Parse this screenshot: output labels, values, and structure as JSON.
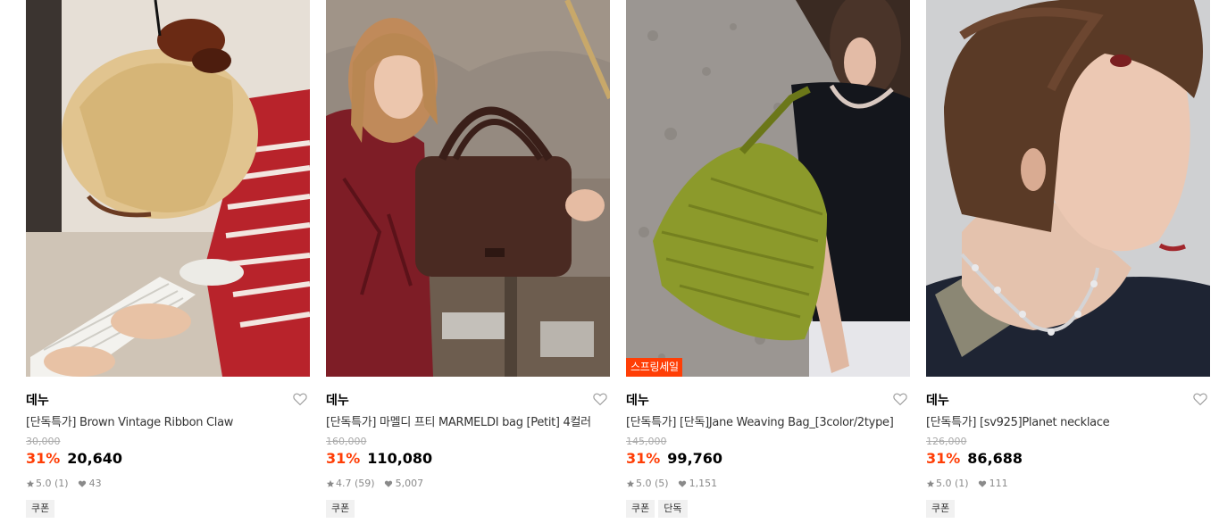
{
  "products": [
    {
      "brand": "데누",
      "title": "[단독특가] Brown Vintage Ribbon Claw",
      "original_price": "30,000",
      "discount": "31%",
      "price": "20,640",
      "rating": "5.0 (1)",
      "likes": "43",
      "tags": [
        "쿠폰"
      ],
      "badge": ""
    },
    {
      "brand": "데누",
      "title": "[단독특가] 마멜디 프티 MARMELDI bag [Petit] 4컬러",
      "original_price": "160,000",
      "discount": "31%",
      "price": "110,080",
      "rating": "4.7 (59)",
      "likes": "5,007",
      "tags": [
        "쿠폰"
      ],
      "badge": ""
    },
    {
      "brand": "데누",
      "title": "[단독특가] [단독]Jane Weaving Bag_[3color/2type]",
      "original_price": "145,000",
      "discount": "31%",
      "price": "99,760",
      "rating": "5.0 (5)",
      "likes": "1,151",
      "tags": [
        "쿠폰",
        "단독"
      ],
      "badge": "스프링세일"
    },
    {
      "brand": "데누",
      "title": "[단독특가] [sv925]Planet necklace",
      "original_price": "126,000",
      "discount": "31%",
      "price": "86,688",
      "rating": "5.0 (1)",
      "likes": "111",
      "tags": [
        "쿠폰"
      ],
      "badge": ""
    }
  ],
  "icons": {
    "wishlist": "heart-outline-icon",
    "rating": "star-icon",
    "likes": "heart-filled-icon"
  },
  "colors": {
    "discount": "#ff3e06",
    "badge_bg": "#ff3e06",
    "tag_bg": "#f1f1f1",
    "meta_text": "#8a8a8a"
  }
}
